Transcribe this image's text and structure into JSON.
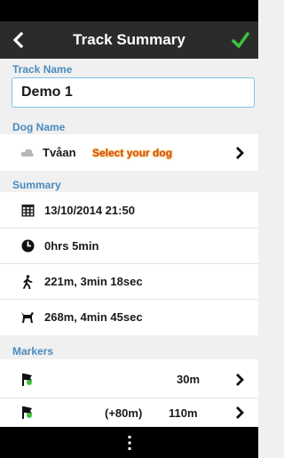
{
  "header": {
    "title": "Track Summary",
    "back_icon": "back-arrow-icon",
    "confirm_icon": "checkmark-icon",
    "confirm_color": "#3cc23c"
  },
  "track_name": {
    "label": "Track Name",
    "value": "Demo 1"
  },
  "dog": {
    "label": "Dog Name",
    "name": "Tvåan",
    "select_text": "Select your dog"
  },
  "summary": {
    "label": "Summary",
    "datetime": "13/10/2014 21:50",
    "duration": "0hrs 5min",
    "walker": "221m, 3min 18sec",
    "dog_stats": "268m, 4min 45sec"
  },
  "markers": {
    "label": "Markers",
    "items": [
      {
        "offset": "",
        "distance": "30m"
      },
      {
        "offset": "(+80m)",
        "distance": "110m"
      }
    ]
  },
  "bottom": {
    "menu_icon": "overflow-menu-icon"
  }
}
